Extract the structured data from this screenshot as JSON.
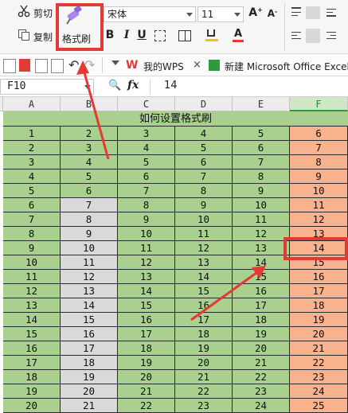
{
  "ribbon": {
    "cut_label": "剪切",
    "copy_label": "复制",
    "format_painter_label": "格式刷",
    "font_name": "宋体",
    "font_size": "11"
  },
  "quickbar": {
    "tab_mywps": "我的WPS",
    "tab_close": "×",
    "tab_doc": "新建 Microsoft Office Excel"
  },
  "formula_bar": {
    "name_box": "F10",
    "fx_label": "fx",
    "value": "14"
  },
  "sheet": {
    "columns": [
      "A",
      "B",
      "C",
      "D",
      "E",
      "F"
    ],
    "title": "如何设置格式刷",
    "rows": [
      [
        "1",
        "2",
        "3",
        "4",
        "5",
        "6"
      ],
      [
        "2",
        "3",
        "4",
        "5",
        "6",
        "7"
      ],
      [
        "3",
        "4",
        "5",
        "6",
        "7",
        "8"
      ],
      [
        "4",
        "5",
        "6",
        "7",
        "8",
        "9"
      ],
      [
        "5",
        "6",
        "7",
        "8",
        "9",
        "10"
      ],
      [
        "6",
        "7",
        "8",
        "9",
        "10",
        "11"
      ],
      [
        "7",
        "8",
        "9",
        "10",
        "11",
        "12"
      ],
      [
        "8",
        "9",
        "10",
        "11",
        "12",
        "13"
      ],
      [
        "9",
        "10",
        "11",
        "12",
        "13",
        "14"
      ],
      [
        "10",
        "11",
        "12",
        "13",
        "14",
        "15"
      ],
      [
        "11",
        "12",
        "13",
        "14",
        "15",
        "16"
      ],
      [
        "12",
        "13",
        "14",
        "15",
        "16",
        "17"
      ],
      [
        "13",
        "14",
        "15",
        "16",
        "17",
        "18"
      ],
      [
        "14",
        "15",
        "16",
        "17",
        "18",
        "19"
      ],
      [
        "15",
        "16",
        "17",
        "18",
        "19",
        "20"
      ],
      [
        "16",
        "17",
        "18",
        "19",
        "20",
        "21"
      ],
      [
        "17",
        "18",
        "19",
        "20",
        "21",
        "22"
      ],
      [
        "18",
        "19",
        "20",
        "21",
        "22",
        "23"
      ],
      [
        "19",
        "20",
        "21",
        "22",
        "23",
        "24"
      ],
      [
        "20",
        "21",
        "22",
        "23",
        "24",
        "25"
      ]
    ],
    "colors": {
      "green": "#a9d08e",
      "gray": "#d9d9d9",
      "orange": "#f8b28e",
      "annotation_red": "#e53935"
    }
  }
}
